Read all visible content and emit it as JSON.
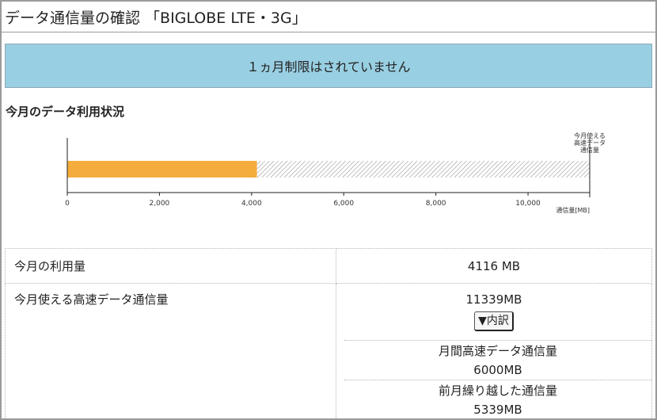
{
  "page": {
    "title": "データ通信量の確認 「BIGLOBE LTE・3G」"
  },
  "notice": {
    "text": "１ヵ月制限はされていません"
  },
  "section": {
    "heading": "今月のデータ利用状況"
  },
  "chart_data": {
    "type": "bar",
    "orientation": "horizontal",
    "used_mb": 4116,
    "available_mb": 11339,
    "xlim": [
      0,
      11339
    ],
    "x_ticks": [
      0,
      2000,
      4000,
      6000,
      8000,
      10000
    ],
    "x_tick_labels": [
      "0",
      "2,000",
      "4,000",
      "6,000",
      "8,000",
      "10,000"
    ],
    "xlabel": "通信量[MB]",
    "end_label_lines": [
      "今月使える",
      "高速データ",
      "通信量"
    ],
    "colors": {
      "used": "#f4ad3d",
      "remaining_hatch": "#9a9a9a"
    }
  },
  "table": {
    "rows": [
      {
        "label": "今月の利用量",
        "value": "4116 MB"
      },
      {
        "label": "今月使える高速データ通信量",
        "value": "11339MB",
        "button_label": "▼内訳",
        "breakdown": [
          {
            "label": "月間高速データ通信量",
            "value": "6000MB"
          },
          {
            "label": "前月繰り越した通信量",
            "value": "5339MB"
          }
        ]
      }
    ]
  }
}
